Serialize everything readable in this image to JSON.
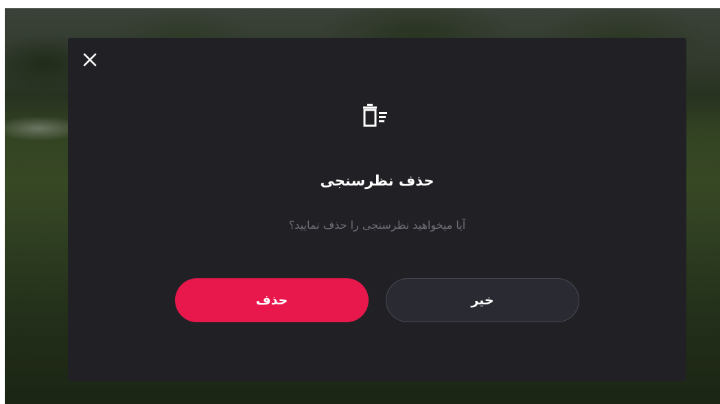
{
  "background": {
    "description_colors": {
      "overlay": "#202025"
    }
  },
  "dialog": {
    "close_icon": "close-icon",
    "header_icon": "trash-list-icon",
    "title": "حذف نظرسنجی",
    "message": "آیا میخواهید نظرسنجی را حذف نمایید؟",
    "confirm_label": "حذف",
    "cancel_label": "خیر",
    "colors": {
      "panel": "#202025",
      "confirm": "#e8184d",
      "cancel": "#2a2a33",
      "cancel_border": "#4a4a55",
      "message": "#6e6e78"
    }
  }
}
